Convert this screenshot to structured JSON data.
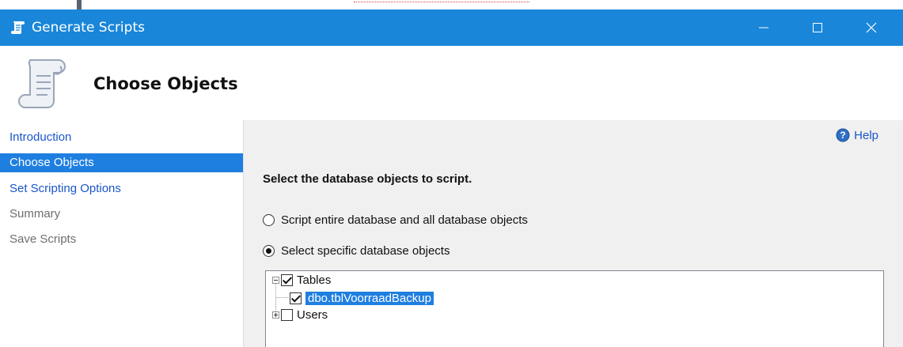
{
  "window": {
    "title": "Generate Scripts",
    "icon": "scroll-icon",
    "controls": {
      "minimize": "minimize-icon",
      "maximize": "maximize-icon",
      "close": "close-icon"
    }
  },
  "header": {
    "title": "Choose Objects",
    "icon": "scroll-icon"
  },
  "nav": {
    "items": [
      {
        "label": "Introduction",
        "state": "link"
      },
      {
        "label": "Choose Objects",
        "state": "selected"
      },
      {
        "label": "Set Scripting Options",
        "state": "link"
      },
      {
        "label": "Summary",
        "state": "disabled"
      },
      {
        "label": "Save Scripts",
        "state": "disabled"
      }
    ]
  },
  "content": {
    "help_label": "Help",
    "instruction": "Select the database objects to script.",
    "options": [
      {
        "label": "Script entire database and all database objects",
        "selected": false
      },
      {
        "label": "Select specific database objects",
        "selected": true
      }
    ],
    "tree": {
      "nodes": [
        {
          "label": "Tables",
          "checked": true,
          "expanded": true
        },
        {
          "label": "dbo.tblVoorraadBackup",
          "checked": true,
          "selected": true
        },
        {
          "label": "Users",
          "checked": false,
          "expanded": false
        }
      ]
    }
  },
  "colors": {
    "titlebar": "#1a86d9",
    "selection": "#1f7fe0",
    "link": "#1a56c8"
  }
}
